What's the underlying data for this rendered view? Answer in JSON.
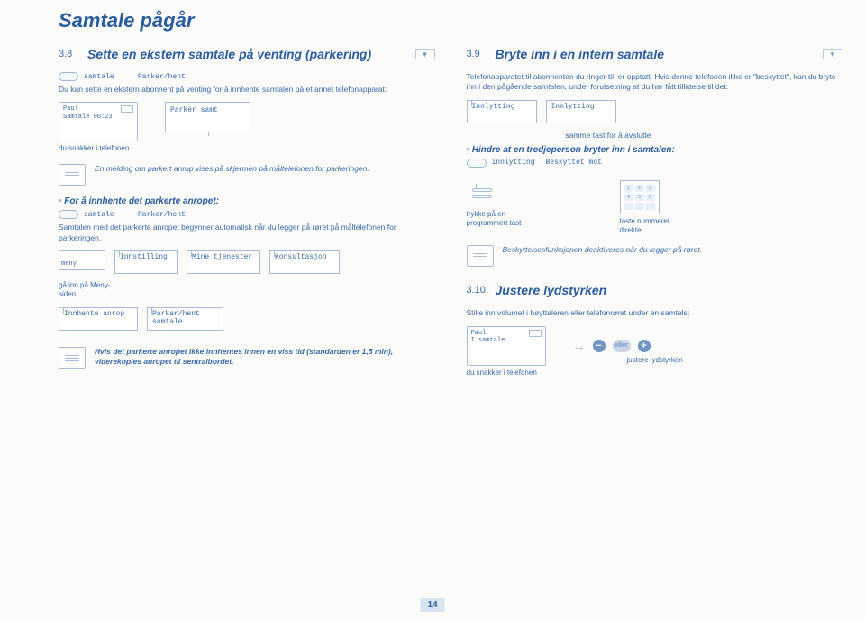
{
  "header": "Samtale pågår",
  "page_num": "14",
  "left": {
    "sec_num": "3.8",
    "sec_title": "Sette en ekstern samtale på venting (parkering)",
    "line1_a": "samtale",
    "line1_b": "Parker/hent",
    "intro": "Du kan sette en ekstern abonnent på venting for å innhente samtalen på et annet telefonapparat:",
    "screen_name": "Paul",
    "screen_status": "Samtale 00:23",
    "screen_cap": "du snakker i telefonen",
    "softkey1": "Parker samt",
    "note1": "En melding om parkert anrop vises på skjermen på måltelefonen for parkeringen.",
    "bullet1": "For å innhente det parkerte anropet:",
    "line2_a": "samtale",
    "line2_b": "Parker/hent",
    "line3": "Samtalen med det parkerte anropet begynner automatisk når du legger på røret på måltelefonen for parkeringen.",
    "menu_label": "meny",
    "chip1": "Innstilling",
    "chip2": "Mine tjenester",
    "chip3": "Konsultasjon",
    "menu_cap": "gå inn på Meny-siden.",
    "chip4": "Innhente anrop",
    "chip5a": "Parker/hent",
    "chip5b": "samtale",
    "note2": "Hvis det parkerte anropet ikke innhentes innen en viss tid (standarden er 1,5 min), viderekoples anropet til sentralbordet."
  },
  "right": {
    "sec_num": "3.9",
    "sec_title": "Bryte inn i en intern samtale",
    "intro": "Telefonapparatet til abonnenten du ringer til, er opptatt. Hvis denne telefonen ikke er \"beskyttet\", kan du bryte inn i den pågående samtalen, under forutsetning at du har fått tillatelse til det:",
    "chip_a": "Innlytting",
    "chip_b": "Innlytting",
    "mid1": "samme tast for å avslutte",
    "bullet2": "Hindre at en tredjeperson bryter inn i samtalen:",
    "line_a": "innlytting",
    "line_b": "Beskyttet mot",
    "prog_cap": "trykke på en programmert tast",
    "keypad_cap": "taste nummeret direkte",
    "note3": "Beskyttelsesfunksjonen deaktiveres når du legger på røret.",
    "sec_num2": "3.10",
    "sec_title2": "Justere lydstyrken",
    "intro2": "Stille inn volumet i høyttaleren eller telefonrøret under en samtale:",
    "screen2_name": "Paul",
    "screen2_status": "I samtale",
    "screen2_cap": "du snakker i telefonen",
    "vol_mid": "eller",
    "vol_cap": "justere lydstyrken"
  }
}
